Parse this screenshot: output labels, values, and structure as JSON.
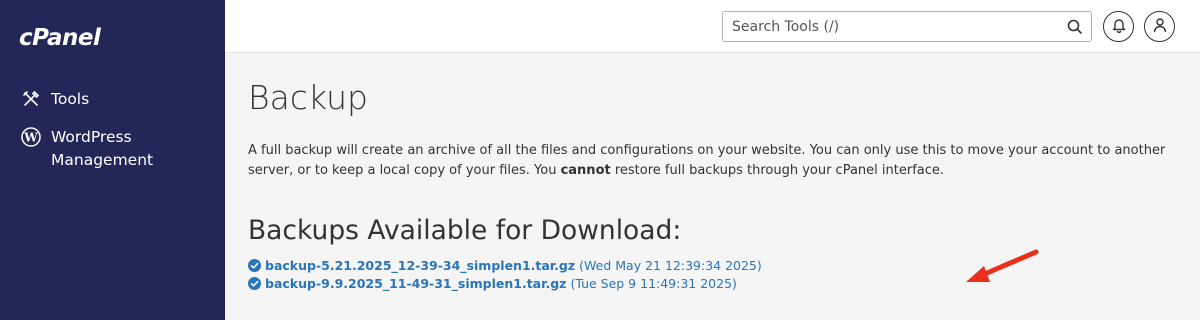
{
  "brand": {
    "logo_text": "cPanel"
  },
  "sidebar": {
    "items": [
      {
        "label": "Tools",
        "icon": "tools-icon"
      },
      {
        "label": "WordPress\nManagement",
        "label_line1": "WordPress",
        "label_line2": "Management",
        "icon": "wordpress-icon"
      }
    ]
  },
  "header": {
    "search_placeholder": "Search Tools (/)",
    "search_value": "",
    "icons": [
      "search-icon",
      "bell-icon",
      "user-icon"
    ]
  },
  "page": {
    "title": "Backup",
    "description_part1": "A full backup will create an archive of all the files and configurations on your website. You can only use this to move your account to another server, or to keep a local copy of your files. You ",
    "description_bold": "cannot",
    "description_part2": " restore full backups through your cPanel interface.",
    "downloads_heading": "Backups Available for Download:",
    "backups": [
      {
        "filename": "backup-5.21.2025_12-39-34_simplen1.tar.gz",
        "date": "(Wed May 21 12:39:34 2025)"
      },
      {
        "filename": "backup-9.9.2025_11-49-31_simplen1.tar.gz",
        "date": "(Tue Sep 9 11:49:31 2025)"
      }
    ]
  },
  "colors": {
    "sidebar_bg": "#232758",
    "link": "#2a74b8",
    "annotation_arrow": "#e8301c"
  }
}
